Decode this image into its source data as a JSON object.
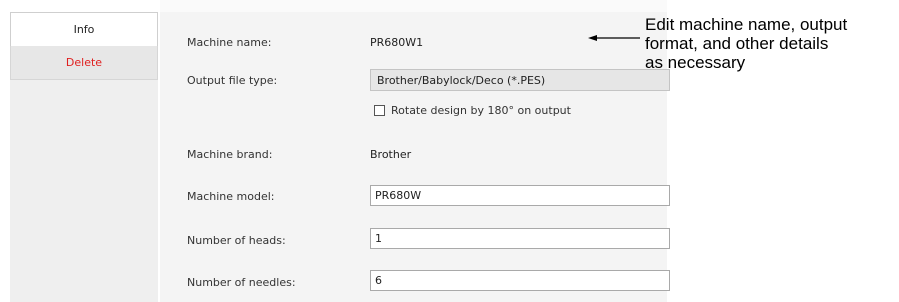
{
  "nav": {
    "items": [
      {
        "label": "Info"
      },
      {
        "label": "Delete"
      }
    ]
  },
  "form": {
    "machine_name": {
      "label": "Machine name:",
      "value": "PR680W1"
    },
    "output_file_type": {
      "label": "Output file type:",
      "value": "Brother/Babylock/Deco (*.PES)"
    },
    "rotate": {
      "label": "Rotate design by 180° on output",
      "checked": false
    },
    "machine_brand": {
      "label": "Machine brand:",
      "value": "Brother"
    },
    "machine_model": {
      "label": "Machine model:",
      "value": "PR680W"
    },
    "number_of_heads": {
      "label": "Number of heads:",
      "value": "1"
    },
    "number_of_needles": {
      "label": "Number of needles:",
      "value": "6"
    }
  },
  "annotation": {
    "lines": [
      "Edit machine name, output",
      "format, and other details",
      "as necessary"
    ]
  }
}
